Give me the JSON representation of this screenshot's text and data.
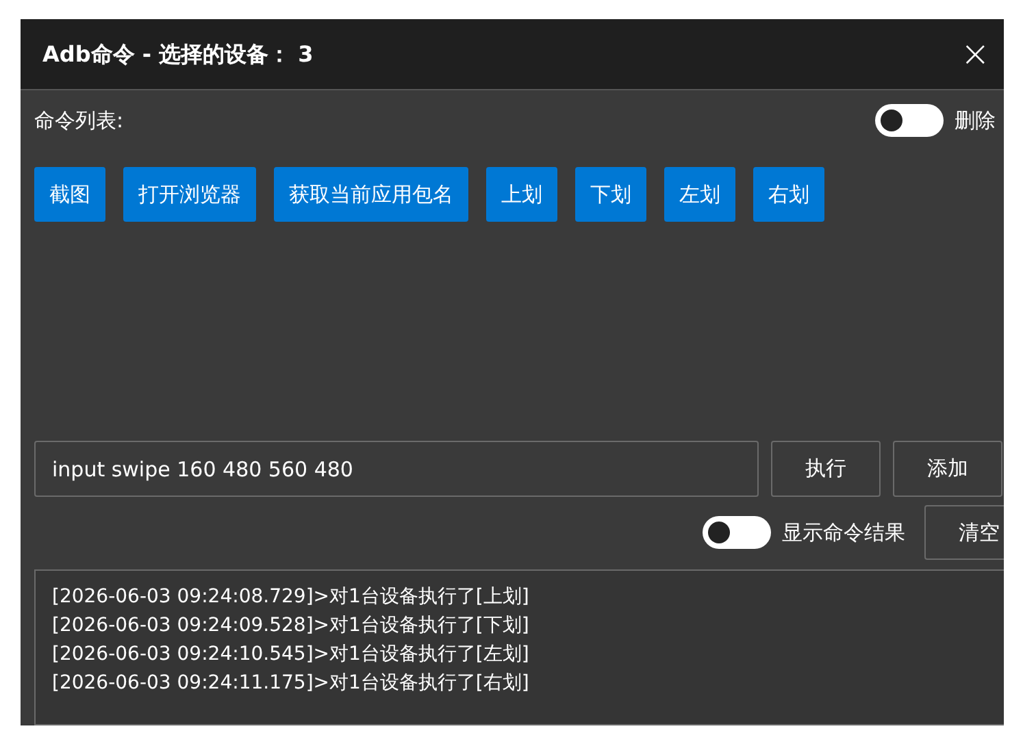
{
  "window": {
    "title": "Adb命令 - 选择的设备： 3",
    "close": "×"
  },
  "command_list": {
    "label": "命令列表:",
    "delete_toggle": {
      "label": "删除",
      "on": false
    },
    "commands": [
      "截图",
      "打开浏览器",
      "获取当前应用包名",
      "上划",
      "下划",
      "左划",
      "右划"
    ]
  },
  "command_input": {
    "value": "input swipe 160 480 560 480"
  },
  "buttons": {
    "execute": "执行",
    "add": "添加",
    "clear": "清空"
  },
  "show_result_toggle": {
    "label": "显示命令结果",
    "on": false
  },
  "log": [
    "[2026-06-03 09:24:08.729]>对1台设备执行了[上划]",
    "[2026-06-03 09:24:09.528]>对1台设备执行了[下划]",
    "[2026-06-03 09:24:10.545]>对1台设备执行了[左划]",
    "[2026-06-03 09:24:11.175]>对1台设备执行了[右划]"
  ]
}
